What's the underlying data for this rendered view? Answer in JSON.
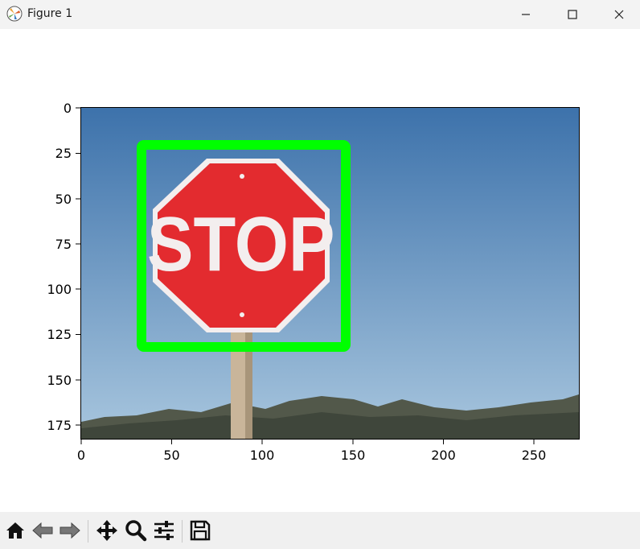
{
  "window": {
    "title": "Figure 1"
  },
  "figure": {
    "x_ticks": [
      "0",
      "50",
      "100",
      "150",
      "200",
      "250"
    ],
    "y_ticks": [
      "0",
      "25",
      "50",
      "75",
      "100",
      "125",
      "150",
      "175"
    ],
    "image": {
      "sign_text": "STOP",
      "box_color": "#00ff00",
      "sign_color": "#e32b2f",
      "sky_top": "#3d74ad",
      "sky_bottom": "#a4c3dc"
    }
  },
  "chart_data": {
    "type": "image",
    "xlim": [
      0,
      275
    ],
    "ylim": [
      183,
      0
    ],
    "x_tick_values": [
      0,
      50,
      100,
      150,
      200,
      250
    ],
    "y_tick_values": [
      0,
      25,
      50,
      75,
      100,
      125,
      150,
      175
    ],
    "bounding_box": {
      "x0": 33,
      "y0": 20,
      "x1": 147,
      "y1": 132,
      "color": "#00ff00"
    }
  },
  "toolbar": {
    "items": [
      "home-icon",
      "back-icon",
      "forward-icon",
      "pan-icon",
      "zoom-icon",
      "configure-subplots-icon",
      "save-icon"
    ]
  }
}
